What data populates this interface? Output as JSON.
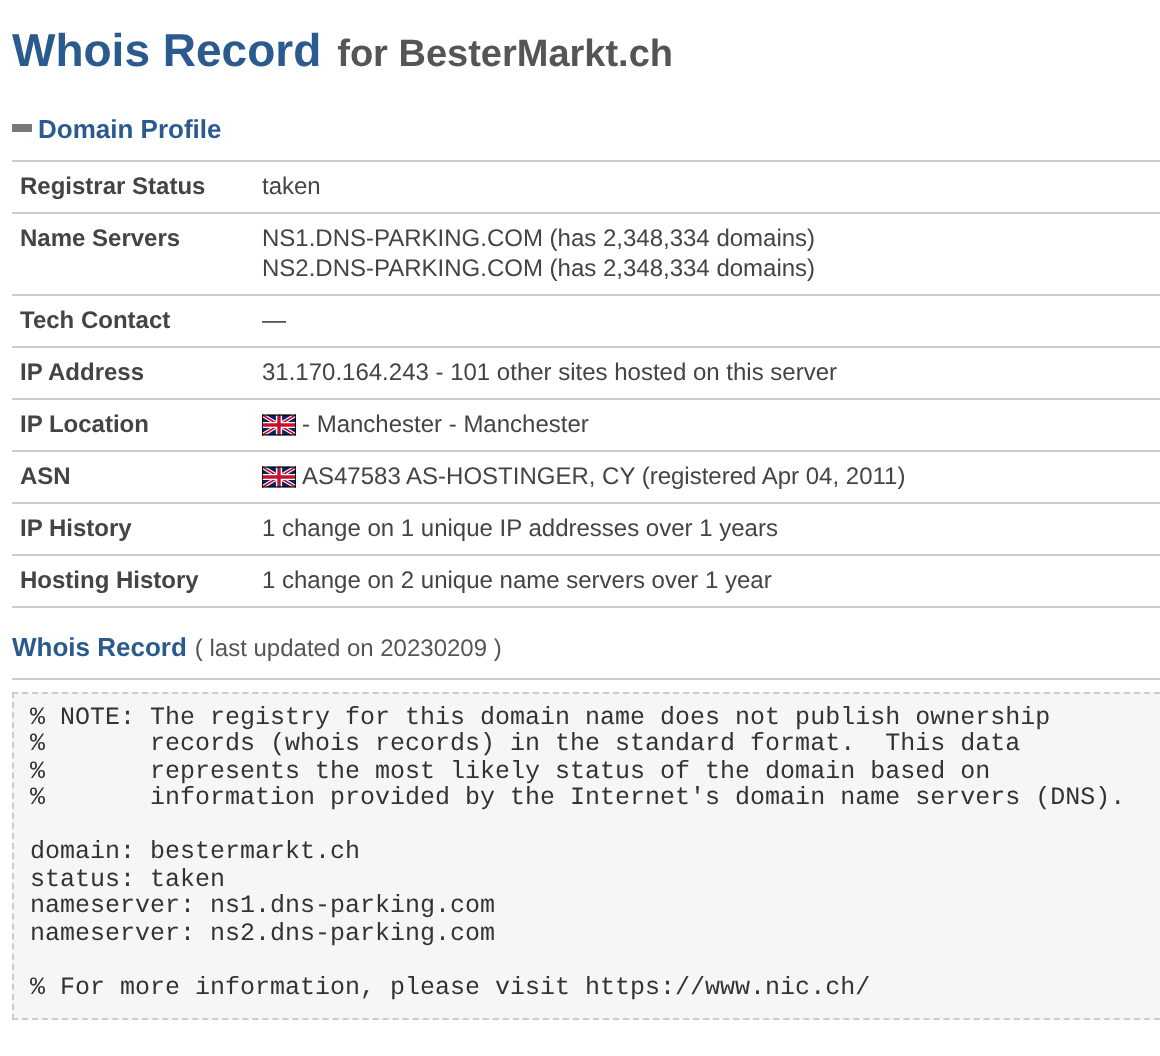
{
  "title": {
    "main": "Whois Record",
    "sub": "for BesterMarkt.ch"
  },
  "domain_profile": {
    "heading": "Domain Profile",
    "expanded": true,
    "rows": [
      {
        "label": "Registrar Status",
        "kind": "text",
        "lines": [
          "taken"
        ]
      },
      {
        "label": "Name Servers",
        "kind": "text",
        "lines": [
          "NS1.DNS-PARKING.COM (has 2,348,334 domains)",
          "NS2.DNS-PARKING.COM (has 2,348,334 domains)"
        ]
      },
      {
        "label": "Tech Contact",
        "kind": "text",
        "lines": [
          "—"
        ]
      },
      {
        "label": "IP Address",
        "kind": "text",
        "lines": [
          "31.170.164.243 - 101 other sites hosted on this server"
        ]
      },
      {
        "label": "IP Location",
        "kind": "flag",
        "lines": [
          "- Manchester - Manchester"
        ]
      },
      {
        "label": "ASN",
        "kind": "flag",
        "lines": [
          "AS47583 AS-HOSTINGER, CY (registered Apr 04, 2011)"
        ]
      },
      {
        "label": "IP History",
        "kind": "text",
        "lines": [
          "1 change on 1 unique IP addresses over 1 years"
        ]
      },
      {
        "label": "Hosting History",
        "kind": "text",
        "lines": [
          "1 change on 2 unique name servers over 1 year"
        ]
      }
    ]
  },
  "whois_record": {
    "heading": "Whois Record",
    "updated": "( last updated on 20230209 )",
    "blocks": [
      [
        "% NOTE: The registry for this domain name does not publish ownership",
        "%       records (whois records) in the standard format.  This data",
        "%       represents the most likely status of the domain based on",
        "%       information provided by the Internet's domain name servers (DNS)."
      ],
      [
        "domain: bestermarkt.ch",
        "status: taken",
        "nameserver: ns1.dns-parking.com",
        "nameserver: ns2.dns-parking.com"
      ],
      [
        "% For more information, please visit https://www.nic.ch/"
      ]
    ]
  }
}
